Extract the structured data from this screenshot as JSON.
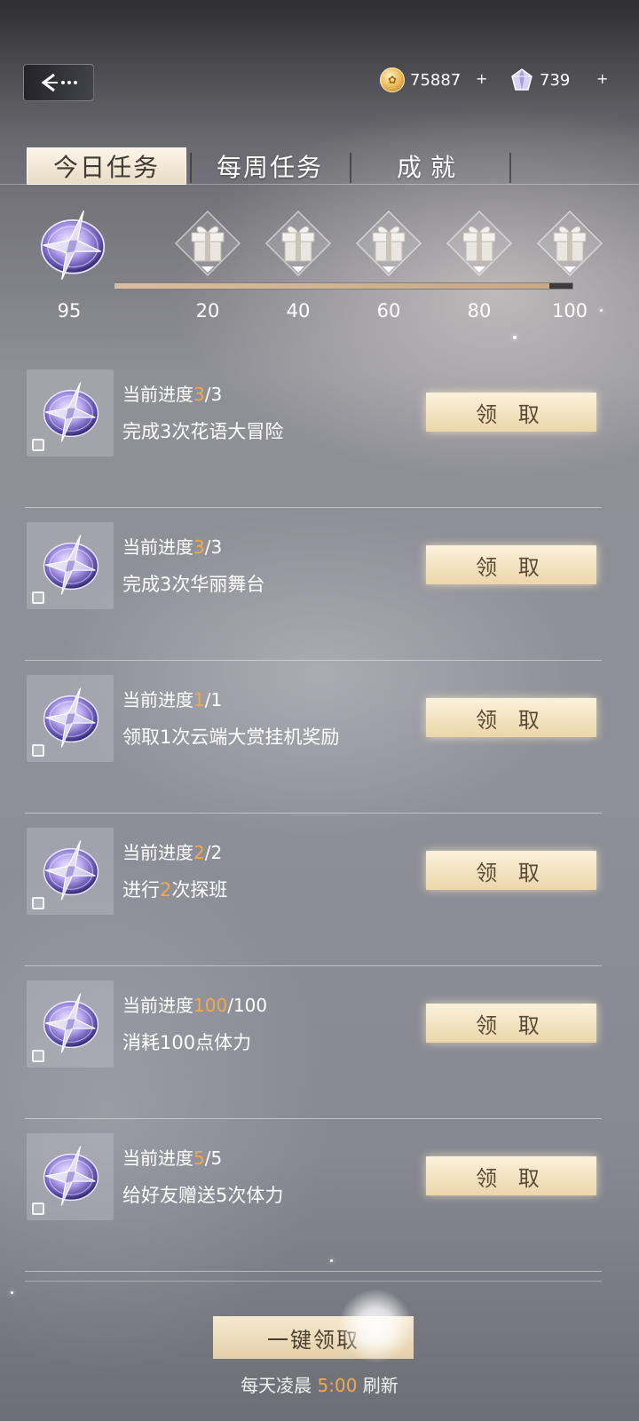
{
  "currency": {
    "coins": "75887",
    "gems": "739",
    "plus": "+"
  },
  "tabs": [
    {
      "label": "今日任务",
      "active": true
    },
    {
      "label": "每周任务",
      "active": false
    },
    {
      "label": "成就",
      "active": false
    }
  ],
  "activity": {
    "current": "95",
    "progress_fraction": 0.95,
    "milestones": [
      "20",
      "40",
      "60",
      "80",
      "100"
    ]
  },
  "tasks": [
    {
      "progress_label": "当前进度",
      "current": "3",
      "total": "/3",
      "desc": "完成3次花语大冒险",
      "button": "领 取"
    },
    {
      "progress_label": "当前进度",
      "current": "3",
      "total": "/3",
      "desc": "完成3次华丽舞台",
      "button": "领 取"
    },
    {
      "progress_label": "当前进度",
      "current": "1",
      "total": "/1",
      "desc": "领取1次云端大赏挂机奖励",
      "button": "领 取"
    },
    {
      "progress_label": "当前进度",
      "current": "2",
      "total": "/2",
      "desc_before": "进行",
      "desc_highlight": "2",
      "desc_after": "次探班",
      "button": "领 取"
    },
    {
      "progress_label": "当前进度",
      "current": "100",
      "total": "/100",
      "desc": "消耗100点体力",
      "button": "领 取"
    },
    {
      "progress_label": "当前进度",
      "current": "5",
      "total": "/5",
      "desc": "给好友赠送5次体力",
      "button": "领 取"
    }
  ],
  "footer": {
    "claim_all": "一键领取",
    "refresh_before": "每天凌晨 ",
    "refresh_time": "5:00",
    "refresh_after": " 刷新"
  },
  "colors": {
    "highlight": "#f0a94c",
    "button_bg": "#f2e1bd",
    "progress_fill": "#d9bfa0"
  },
  "icons": [
    "back-arrow-icon",
    "coin-icon",
    "gem-icon",
    "plus-icon",
    "activity-star-icon",
    "gift-icon",
    "reward-star-icon"
  ]
}
